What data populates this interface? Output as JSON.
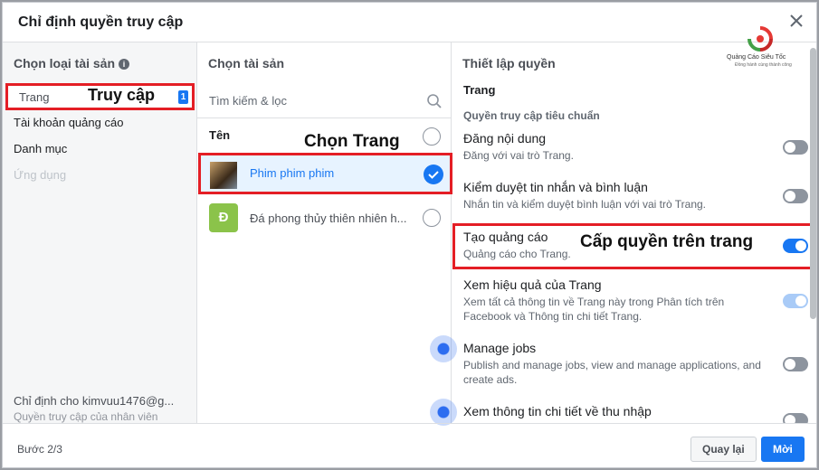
{
  "dialog": {
    "title": "Chỉ định quyền truy cập"
  },
  "asset_types": {
    "heading": "Chọn loại tài sản",
    "selected": {
      "label": "Trang",
      "annotation": "Truy cập",
      "count": "1"
    },
    "items": [
      "Tài khoản quảng cáo",
      "Danh mục",
      "Ứng dụng"
    ],
    "assigned_to": "Chỉ định cho kimvuu1476@g...",
    "assigned_role": "Quyền truy cập của nhân viên"
  },
  "assets": {
    "heading": "Chọn tài sản",
    "search_placeholder": "Tìm kiếm & lọc",
    "name_header": "Tên",
    "annotation": "Chọn Trang",
    "pages": [
      {
        "name": "Phim phim phim",
        "selected": true
      },
      {
        "name": "Đá phong thủy thiên nhiên h...",
        "initial": "Đ",
        "selected": false
      }
    ]
  },
  "permissions": {
    "heading": "Thiết lập quyền",
    "section": "Trang",
    "subsection": "Quyền truy cập tiêu chuẩn",
    "annotation": "Cấp quyền trên trang",
    "brand": {
      "name": "Quảng Cáo Siêu Tốc",
      "tagline": "Đồng hành cùng thành công"
    },
    "items": [
      {
        "title": "Đăng nội dung",
        "desc": "Đăng với vai trò Trang.",
        "state": "off"
      },
      {
        "title": "Kiểm duyệt tin nhắn và bình luận",
        "desc": "Nhắn tin và kiểm duyệt bình luận với vai trò Trang.",
        "state": "off"
      },
      {
        "title": "Tạo quảng cáo",
        "desc": "Quảng cáo cho Trang.",
        "state": "on"
      },
      {
        "title": "Xem hiệu quả của Trang",
        "desc": "Xem tất cả thông tin về Trang này trong Phân tích trên Facebook và Thông tin chi tiết Trang.",
        "state": "on-disabled"
      },
      {
        "title": "Manage jobs",
        "desc": "Publish and manage jobs, view and manage applications, and create ads.",
        "state": "off"
      },
      {
        "title": "Xem thông tin chi tiết về thu nhập",
        "desc": "",
        "state": "off"
      }
    ]
  },
  "footer": {
    "step": "Bước 2/3",
    "back_label": "Quay lại",
    "next_label": "Mời"
  },
  "colors": {
    "accent": "#1877f2",
    "highlight_box": "#e41e25"
  }
}
